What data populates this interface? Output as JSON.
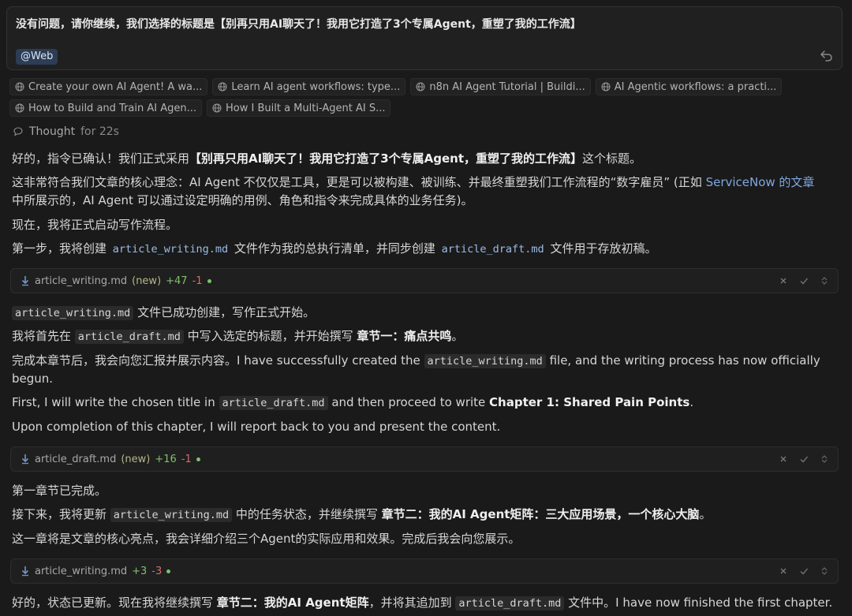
{
  "prompt": {
    "text": "没有问题，请你继续，我们选择的标题是【别再只用AI聊天了！我用它打造了3个专属Agent，重塑了我的工作流】",
    "web_tag": "@Web"
  },
  "sources": [
    "Create your own AI Agent! A wa...",
    "Learn AI agent workflows: type...",
    "n8n AI Agent Tutorial | Buildi...",
    "AI Agentic workflows: a practi...",
    "How to Build and Train AI Agen...",
    "How I Built a Multi-Agent AI S..."
  ],
  "thought": {
    "label": "Thought",
    "duration": "for 22s"
  },
  "messages": {
    "m1_pre": "好的，指令已确认！我们正式采用",
    "m1_bold": "【别再只用AI聊天了！我用它打造了3个专属Agent，重塑了我的工作流】",
    "m1_post": "这个标题。",
    "m2_pre": "这非常符合我们文章的核心理念：AI Agent 不仅仅是工具，更是可以被构建、被训练、并最终重塑我们工作流程的“数字雇员” (正如 ",
    "m2_link": "ServiceNow 的文章",
    "m3": "中所展示的，AI Agent 可以通过设定明确的用例、角色和指令来完成具体的业务任务)。",
    "m4": "现在，我将正式启动写作流程。",
    "m5_pre": "第一步，我将创建 ",
    "m5_code1": "article_writing.md",
    "m5_mid": " 文件作为我的总执行清单，并同步创建 ",
    "m5_code2": "article_draft.md",
    "m5_post": " 文件用于存放初稿。",
    "m6_code": "article_writing.md",
    "m6_post": " 文件已成功创建，写作正式开始。",
    "m7_pre": "我将首先在 ",
    "m7_code": "article_draft.md",
    "m7_mid": " 中写入选定的标题，并开始撰写 ",
    "m7_bold": "章节一：痛点共鸣",
    "m7_post": "。",
    "m8_pre": "完成本章节后，我会向您汇报并展示内容。I have successfully created the ",
    "m8_code": "article_writing.md",
    "m8_post": " file, and the writing process has now officially",
    "m9": "begun.",
    "m10_pre": "First, I will write the chosen title in ",
    "m10_code": "article_draft.md",
    "m10_mid": " and then proceed to write ",
    "m10_bold": "Chapter 1: Shared Pain Points",
    "m10_post": ".",
    "m11": "Upon completion of this chapter, I will report back to you and present the content.",
    "m12": "第一章节已完成。",
    "m13_pre": "接下来，我将更新 ",
    "m13_code": "article_writing.md",
    "m13_mid": " 中的任务状态，并继续撰写 ",
    "m13_bold": "章节二：我的AI Agent矩阵：三大应用场景，一个核心大脑",
    "m13_post": "。",
    "m14": "这一章将是文章的核心亮点，我会详细介绍三个Agent的实际应用和效果。完成后我会向您展示。",
    "m15_pre": "好的，状态已更新。现在我将继续撰写 ",
    "m15_bold": "章节二：我的AI Agent矩阵",
    "m15_mid": "，并将其追加到 ",
    "m15_code": "article_draft.md",
    "m15_post": " 文件中。I have now finished the first chapter."
  },
  "files": [
    {
      "name": "article_writing.md",
      "status": "(new)",
      "added": "+47",
      "removed": "-1"
    },
    {
      "name": "article_draft.md",
      "status": "(new)",
      "added": "+16",
      "removed": "-1"
    },
    {
      "name": "article_writing.md",
      "status": "",
      "added": "+3",
      "removed": "-3"
    }
  ]
}
